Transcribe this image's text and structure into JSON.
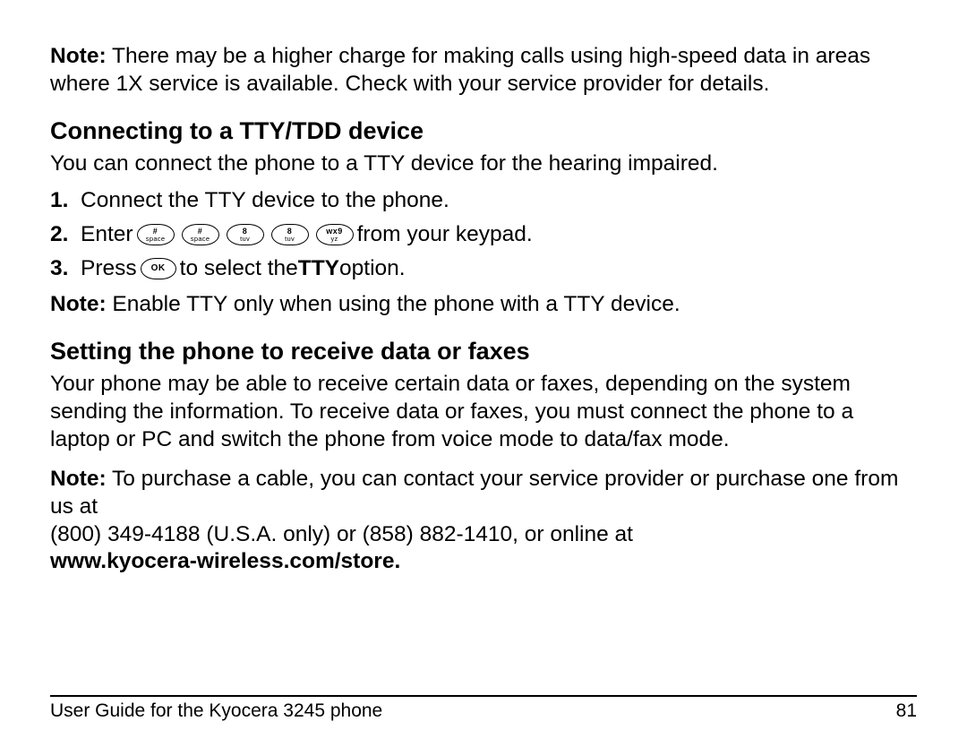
{
  "note_label": "Note:",
  "intro_note_text": " There may be a higher charge for making calls using high-speed data in areas where 1X service is available. Check with your service provider for details.",
  "tty": {
    "heading": "Connecting to a TTY/TDD device",
    "intro": "You can connect the phone to a TTY device for the hearing impaired.",
    "step1_num": "1.",
    "step1_text": "Connect the TTY device to the phone.",
    "step2_num": "2.",
    "step2_pre": "Enter ",
    "step2_post": " from your keypad.",
    "keys": {
      "hash_top": "#",
      "hash_bot": "space",
      "eight_top": "8",
      "eight_bot": "tuv",
      "nine_top": "wx9",
      "nine_bot": "yz"
    },
    "step3_num": "3.",
    "step3_pre": "Press ",
    "ok_label": "OK",
    "step3_mid": " to select the ",
    "step3_bold": "TTY",
    "step3_post": " option.",
    "note_text": " Enable TTY only when using the phone with a TTY device."
  },
  "fax": {
    "heading": "Setting the phone to receive data or faxes",
    "body": "Your phone may be able to receive certain data or faxes, depending on the system sending the information. To receive data or faxes, you must connect the phone to a laptop or PC and switch the phone from voice mode to data/fax mode.",
    "note_text": " To purchase a cable, you can contact your service provider or purchase one from us at",
    "phones": "(800) 349-4188 (U.S.A. only) or (858) 882-1410, or online at ",
    "url": "www.kyocera-wireless.com/store"
  },
  "footer": {
    "left": "User Guide for the Kyocera 3245 phone",
    "right": "81"
  }
}
